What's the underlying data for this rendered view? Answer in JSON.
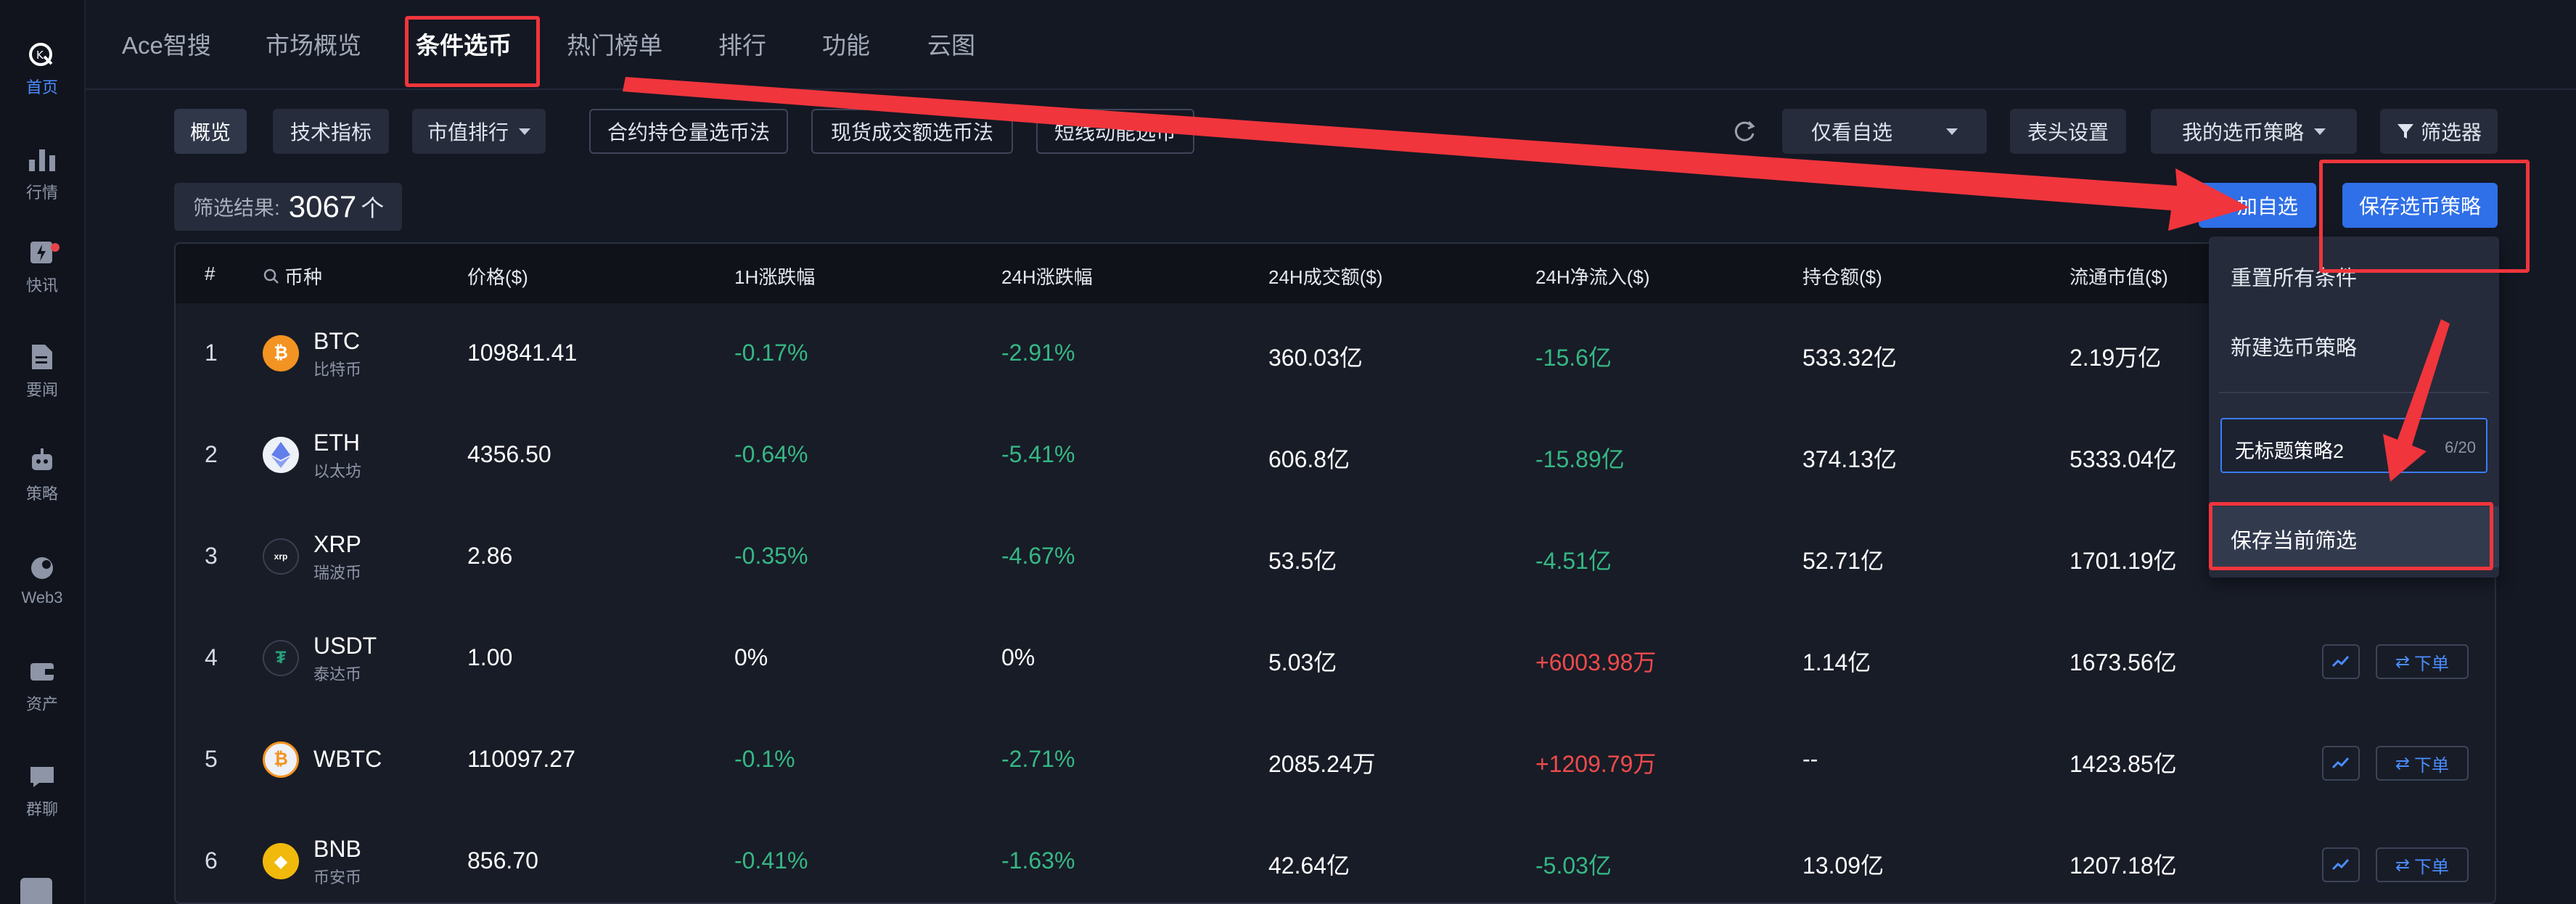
{
  "sidebar": {
    "items": [
      {
        "label": "首页",
        "icon": "home-logo-icon",
        "active": true
      },
      {
        "label": "行情",
        "icon": "bar-chart-icon"
      },
      {
        "label": "快讯",
        "icon": "news-flash-icon",
        "badge": true
      },
      {
        "label": "要闻",
        "icon": "document-icon"
      },
      {
        "label": "策略",
        "icon": "robot-icon"
      },
      {
        "label": "Web3",
        "icon": "web3-icon"
      },
      {
        "label": "资产",
        "icon": "wallet-icon"
      },
      {
        "label": "群聊",
        "icon": "chat-icon"
      }
    ]
  },
  "nav": {
    "tabs": [
      "Ace智搜",
      "市场概览",
      "条件选币",
      "热门榜单",
      "排行",
      "功能",
      "云图"
    ],
    "active": "条件选币"
  },
  "toolbar": {
    "overview": "概览",
    "tech": "技术指标",
    "mcap_rank": "市值排行",
    "contract_oi": "合约持仓量选币法",
    "spot_volume": "现货成交额选币法",
    "short_momentum": "短线动能选币",
    "watchlist_only": "仅看自选",
    "header_settings": "表头设置",
    "my_strategy": "我的选币策略",
    "filter": "筛选器",
    "add_watch": "加自选",
    "save_strategy": "保存选币策略"
  },
  "result": {
    "label": "筛选结果:",
    "count": "3067",
    "unit": "个"
  },
  "table": {
    "headers": [
      "#",
      "币种",
      "价格($)",
      "1H涨跌幅",
      "24H涨跌幅",
      "24H成交额($)",
      "24H净流入($)",
      "持仓额($)",
      "流通市值($)"
    ],
    "order_label": "下单",
    "rows": [
      {
        "rank": "1",
        "sym": "BTC",
        "name": "比特币",
        "price": "109841.41",
        "h1": "-0.17%",
        "h24": "-2.91%",
        "vol": "360.03亿",
        "inflow": "-15.6亿",
        "oi": "533.32亿",
        "mcap": "2.19万亿"
      },
      {
        "rank": "2",
        "sym": "ETH",
        "name": "以太坊",
        "price": "4356.50",
        "h1": "-0.64%",
        "h24": "-5.41%",
        "vol": "606.8亿",
        "inflow": "-15.89亿",
        "oi": "374.13亿",
        "mcap": "5333.04亿"
      },
      {
        "rank": "3",
        "sym": "XRP",
        "name": "瑞波币",
        "price": "2.86",
        "h1": "-0.35%",
        "h24": "-4.67%",
        "vol": "53.5亿",
        "inflow": "-4.51亿",
        "oi": "52.71亿",
        "mcap": "1701.19亿"
      },
      {
        "rank": "4",
        "sym": "USDT",
        "name": "泰达币",
        "price": "1.00",
        "h1": "0%",
        "h24": "0%",
        "vol": "5.03亿",
        "inflow": "+6003.98万",
        "oi": "1.14亿",
        "mcap": "1673.56亿"
      },
      {
        "rank": "5",
        "sym": "WBTC",
        "name": "",
        "price": "110097.27",
        "h1": "-0.1%",
        "h24": "-2.71%",
        "vol": "2085.24万",
        "inflow": "+1209.79万",
        "oi": "--",
        "mcap": "1423.85亿"
      },
      {
        "rank": "6",
        "sym": "BNB",
        "name": "币安币",
        "price": "856.70",
        "h1": "-0.41%",
        "h24": "-1.63%",
        "vol": "42.64亿",
        "inflow": "-5.03亿",
        "oi": "13.09亿",
        "mcap": "1207.18亿"
      }
    ]
  },
  "dropdown": {
    "reset": "重置所有条件",
    "new": "新建选币策略",
    "input_value": "无标题策略2",
    "input_count": "6/20",
    "save_current": "保存当前筛选"
  },
  "colors": {
    "up": "#ef4b4b",
    "down": "#35b884",
    "accent": "#2f6fe8",
    "annotation": "#f0353c"
  }
}
